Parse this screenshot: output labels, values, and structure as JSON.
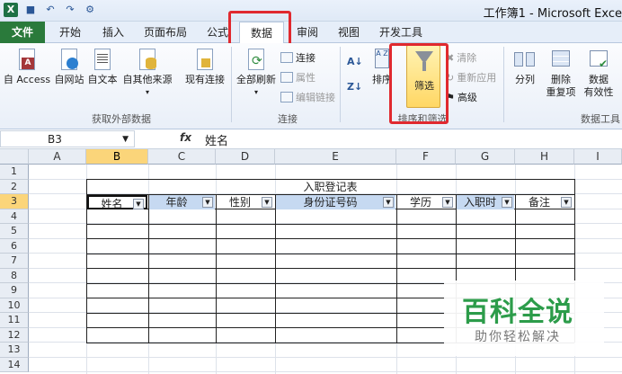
{
  "window": {
    "title": "工作簿1 - Microsoft Exce"
  },
  "qat": {
    "save_icon": "save-icon",
    "undo_icon": "undo-icon",
    "redo_icon": "redo-icon"
  },
  "tabs": [
    {
      "label": "文件"
    },
    {
      "label": "开始"
    },
    {
      "label": "插入"
    },
    {
      "label": "页面布局"
    },
    {
      "label": "公式"
    },
    {
      "label": "数据"
    },
    {
      "label": "审阅"
    },
    {
      "label": "视图"
    },
    {
      "label": "开发工具"
    }
  ],
  "ribbon": {
    "external": {
      "access": "自 Access",
      "web": "自网站",
      "text": "自文本",
      "other": "自其他来源",
      "existing": "现有连接",
      "group": "获取外部数据"
    },
    "connections": {
      "refresh": "全部刷新",
      "connect": "连接",
      "props": "属性",
      "edit_links": "编辑链接",
      "group": "连接"
    },
    "sort": {
      "sort": "排序",
      "filter": "筛选",
      "clear": "清除",
      "reapply": "重新应用",
      "advanced": "高级",
      "group": "排序和筛选"
    },
    "tools": {
      "split": "分列",
      "remove_dup_1": "删除",
      "remove_dup_2": "重复项",
      "validation_1": "数据",
      "validation_2": "有效性",
      "group": "数据工具"
    }
  },
  "formula_bar": {
    "cell": "B3",
    "fx": "fx",
    "value": "姓名"
  },
  "columns": [
    "A",
    "B",
    "C",
    "D",
    "E",
    "F",
    "G",
    "H",
    "I"
  ],
  "rows": [
    "1",
    "2",
    "3",
    "4",
    "5",
    "6",
    "7",
    "8",
    "9",
    "10",
    "11",
    "12",
    "13",
    "14"
  ],
  "table": {
    "title": "入职登记表",
    "headers": [
      "姓名",
      "年龄",
      "性别",
      "身份证号码",
      "学历",
      "入职时",
      "备注"
    ]
  },
  "watermark": {
    "line1": "百科全说",
    "line2": "助你轻松解决"
  }
}
